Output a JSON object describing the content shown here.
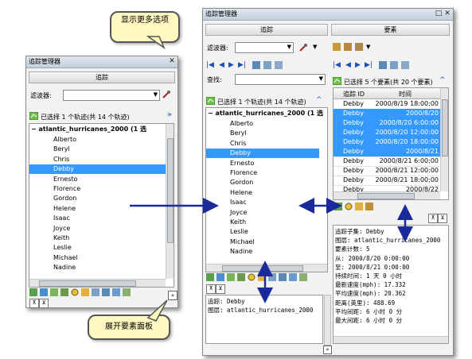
{
  "callouts": {
    "more_options": "显示更多选项",
    "expand_panel": "展开要素面板"
  },
  "left": {
    "title": "追踪管理器",
    "tab": "追踪",
    "filter_label": "滤波器:",
    "selected_text": "已选择 1 个轨迹(共 14 个轨迹)",
    "group": "atlantic_hurricanes_2000  (1 选",
    "items": [
      "Alberto",
      "Beryl",
      "Chris",
      "Debby",
      "Ernesto",
      "Florence",
      "Gordon",
      "Helene",
      "Isaac",
      "Joyce",
      "Keith",
      "Leslie",
      "Michael",
      "Nadine"
    ],
    "selected": "Debby"
  },
  "right": {
    "title": "追踪管理器",
    "tab_track": "追踪",
    "tab_feature": "要素",
    "filter_label": "滤波器:",
    "find_label": "查找:",
    "selected_text": "已选择 1 个轨迹(共 14 个轨迹)",
    "group": "atlantic_hurricanes_2000  (1 选",
    "items": [
      "Alberto",
      "Beryl",
      "Chris",
      "Debby",
      "Ernesto",
      "Florence",
      "Gordon",
      "Helene",
      "Isaac",
      "Joyce",
      "Keith",
      "Leslie",
      "Michael",
      "Nadine"
    ],
    "selected": "Debby",
    "feature_selected_text": "已选择 5 个要素(共 20 个要素)",
    "columns": [
      "追踪 ID",
      "时间"
    ],
    "rows": [
      {
        "id": "Debby",
        "time": "2000/8/19 18:00:00",
        "sel": false
      },
      {
        "id": "Debby",
        "time": "2000/8/20",
        "sel": true
      },
      {
        "id": "Debby",
        "time": "2000/8/20 6:00:00",
        "sel": true
      },
      {
        "id": "Debby",
        "time": "2000/8/20 12:00:00",
        "sel": true
      },
      {
        "id": "Debby",
        "time": "2000/8/20 18:00:00",
        "sel": true
      },
      {
        "id": "Debby",
        "time": "2000/8/21",
        "sel": true
      },
      {
        "id": "Debby",
        "time": "2000/8/21 6:00:00",
        "sel": false
      },
      {
        "id": "Debby",
        "time": "2000/8/21 12:00:00",
        "sel": false
      },
      {
        "id": "Debby",
        "time": "2000/8/21 18:00:00",
        "sel": false
      },
      {
        "id": "Debby",
        "time": "2000/8/22",
        "sel": false
      }
    ],
    "track_info": [
      {
        "label": "追踪:",
        "value": "Debby"
      },
      {
        "label": "图层:",
        "value": "atlantic_hurricanes_2000"
      }
    ],
    "feature_info": [
      {
        "label": "追踪子集:",
        "value": "Debby"
      },
      {
        "label": "图层:",
        "value": "atlantic_hurricanes_2000"
      },
      {
        "label": "要素计数:",
        "value": "5"
      },
      {
        "label": "从:",
        "value": "2000/8/20 0:00:00"
      },
      {
        "label": "至:",
        "value": "2000/8/21 0:00:00"
      },
      {
        "label": "持续时间:",
        "value": "1 天 0 小时"
      },
      {
        "label": "最新速度(mph):",
        "value": "17.332"
      },
      {
        "label": "平均速度(mph):",
        "value": "20.362"
      },
      {
        "label": "距离(英里):",
        "value": "488.69"
      },
      {
        "label": "平均间距:",
        "value": "6 小时 0 分"
      },
      {
        "label": "最大间距:",
        "value": "6 小时 0 分"
      }
    ]
  },
  "colors": {
    "selection": "#3399ff",
    "arrow": "#1a2a9a",
    "callout_bg": "#fff8c0"
  }
}
